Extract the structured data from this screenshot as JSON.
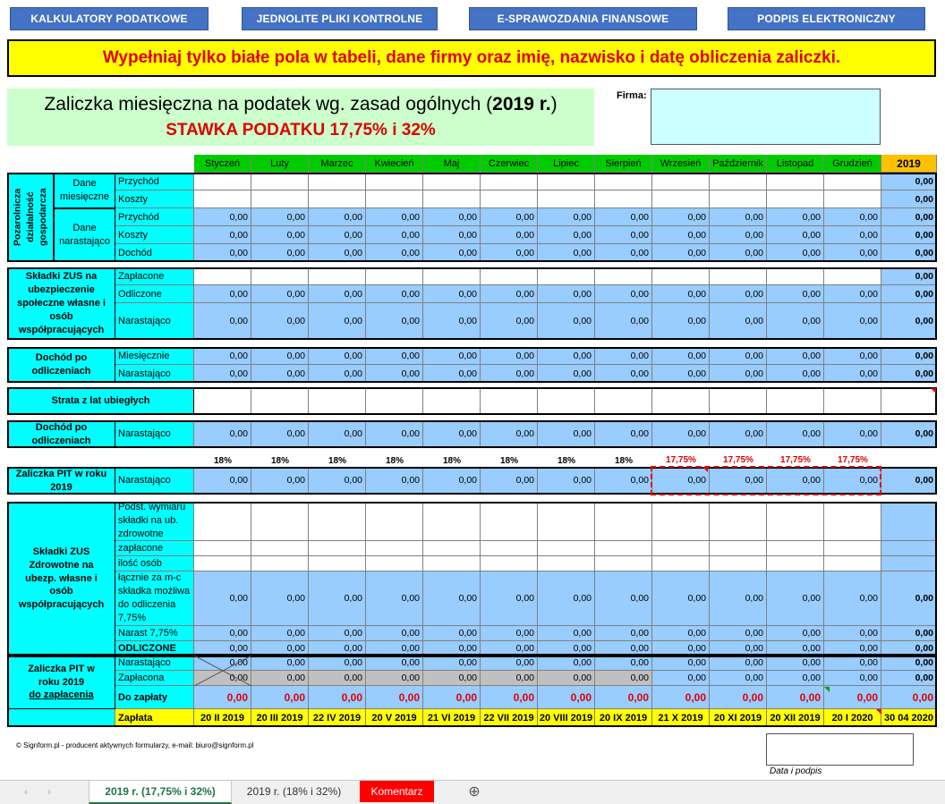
{
  "nav": [
    {
      "label": "KALKULATORY PODATKOWE"
    },
    {
      "label": "JEDNOLITE PLIKI KONTROLNE"
    },
    {
      "label": "E-SPRAWOZDANIA FINANSOWE"
    },
    {
      "label": "PODPIS ELEKTRONICZNY"
    }
  ],
  "banner": "Wypełniaj tylko białe pola w tabeli, dane firmy oraz imię, nazwisko i datę obliczenia zaliczki.",
  "title": {
    "main": "Zaliczka miesięczna na podatek wg. zasad ogólnych (",
    "year": "2019 r.",
    "close": ")",
    "rate": "STAWKA PODATKU 17,75% i 32%"
  },
  "firma_label": "Firma:",
  "months": [
    "Styczeń",
    "Luty",
    "Marzec",
    "Kwiecień",
    "Maj",
    "Czerwiec",
    "Lipiec",
    "Sierpień",
    "Wrzesień",
    "Październik",
    "Listopad",
    "Grudzień"
  ],
  "year_header": "2019",
  "zero": "0,00",
  "groups": {
    "pozarolnicza": "Pozarolnicza działalność gospodarcza",
    "dane_miesieczne": "Dane miesięczne",
    "dane_narastajaco": "Dane narastająco",
    "zus_spoleczne": "Składki ZUS na ubezpieczenie społeczne własne i osób współpracujących",
    "dochod_po1": "Dochód po odliczeniach",
    "strata": "Strata z lat ubiegłych",
    "dochod_po2": "Dochód po odliczeniach",
    "zaliczka_pit": "Zaliczka PIT w roku 2019",
    "zus_zdrowotne": "Składki ZUS Zdrowotne na ubezp. własne i osób współpracujących",
    "zaliczka_zap_a": "Zaliczka PIT w roku 2019",
    "zaliczka_zap_b": "do zapłacenia"
  },
  "labels": {
    "przychod": "Przychód",
    "koszty": "Koszty",
    "dochod": "Dochód",
    "zaplacone": "Zapłacone",
    "odliczone": "Odliczone",
    "narastajaco": "Narastająco",
    "miesiecznie": "Miesięcznie",
    "podst": "Podst. wymiaru składki na ub. zdrowotne",
    "zaplacone_lc": "zapłacone",
    "ilosc": "ilość osób",
    "lacznie": "łącznie za m-c składka możliwa do odliczenia 7,75%",
    "narast775": "Narast 7,75%",
    "odliczone_caps": "ODLICZONE",
    "zaplacona": "Zapłacona",
    "do_zaplaty": "Do zapłaty",
    "zaplata": "Zapłata"
  },
  "percents": [
    "18%",
    "18%",
    "18%",
    "18%",
    "18%",
    "18%",
    "18%",
    "18%",
    "17,75%",
    "17,75%",
    "17,75%",
    "17,75%"
  ],
  "payment_dates": [
    "20 II 2019",
    "20 III 2019",
    "22 IV 2019",
    "20 V 2019",
    "21 VI 2019",
    "22 VII 2019",
    "20 VIII 2019",
    "20 IX 2019",
    "21 X 2019",
    "20 XI 2019",
    "20 XII 2019",
    "20 I 2020",
    "30 04 2020"
  ],
  "footer": "© Signform.pl - producent aktywnych formularzy, e-mail: biuro@signform.pl",
  "signature_label": "Data i podpis",
  "tabs": [
    {
      "label": "2019 r. (17,75% i 32%)"
    },
    {
      "label": "2019 r. (18% i 32%)"
    },
    {
      "label": "Komentarz"
    }
  ],
  "colors": {
    "nav": "#4472c4",
    "banner_bg": "#ffff00",
    "banner_text": "#e00000",
    "cyan": "#00ffff",
    "blue": "#99ccff",
    "month_header": "#00cc00",
    "year_header": "#ffc000"
  }
}
